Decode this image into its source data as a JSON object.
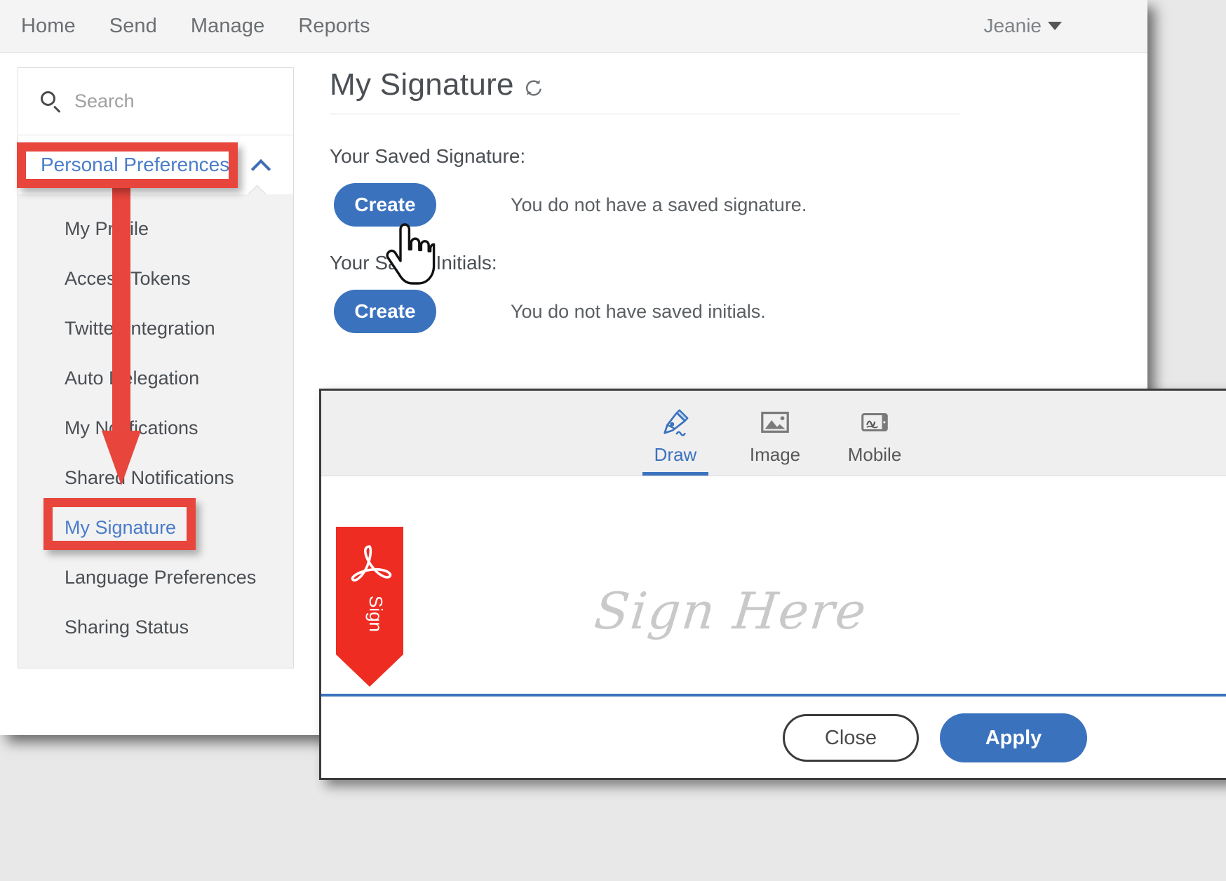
{
  "topnav": {
    "links": [
      {
        "label": "Home"
      },
      {
        "label": "Send"
      },
      {
        "label": "Manage"
      },
      {
        "label": "Reports"
      }
    ],
    "user": {
      "name": "Jeanie",
      "caret_icon": "chevron-down-icon"
    }
  },
  "sidebar": {
    "search": {
      "placeholder": "Search",
      "value": "",
      "icon": "search-icon"
    },
    "group": {
      "label": "Personal Preferences",
      "expanded": true,
      "toggle_icon": "chevron-up-icon"
    },
    "items": [
      {
        "label": "My Profile",
        "active": false
      },
      {
        "label": "Access Tokens",
        "active": false
      },
      {
        "label": "Twitter Integration",
        "active": false
      },
      {
        "label": "Auto Delegation",
        "active": false
      },
      {
        "label": "My Notifications",
        "active": false
      },
      {
        "label": "Shared Notifications",
        "active": false
      },
      {
        "label": "My Signature",
        "active": true
      },
      {
        "label": "Language Preferences",
        "active": false
      },
      {
        "label": "Sharing Status",
        "active": false
      }
    ]
  },
  "main": {
    "title": "My Signature",
    "refresh_icon": "refresh-icon",
    "signature_section": {
      "label": "Your Saved Signature:",
      "button_label": "Create",
      "status_text": "You do not have a saved signature."
    },
    "initials_section": {
      "label": "Your Saved Initials:",
      "button_label": "Create",
      "status_text": "You do not have saved initials."
    },
    "cursor_icon": "hand-pointer-cursor"
  },
  "signature_modal": {
    "tabs": [
      {
        "label": "Draw",
        "icon": "pen-draw-icon",
        "active": true
      },
      {
        "label": "Image",
        "icon": "image-picture-icon",
        "active": false
      },
      {
        "label": "Mobile",
        "icon": "mobile-tablet-signature-icon",
        "active": false
      }
    ],
    "canvas": {
      "flag_icon": "adobe-acrobat-sign-flag-icon",
      "flag_label": "Sign",
      "placeholder_text": "Sign Here",
      "baseline_color": "#3b72bd"
    },
    "footer": {
      "close_label": "Close",
      "apply_label": "Apply"
    }
  },
  "annotations": {
    "highlight_color": "#e8453c",
    "boxes": [
      {
        "target": "Personal Preferences"
      },
      {
        "target": "My Signature"
      }
    ],
    "arrow": {
      "direction": "down"
    }
  },
  "colors": {
    "accent_blue": "#3b72bd",
    "link_blue": "#4a7cc9",
    "annotation_red": "#e8453c",
    "acrobat_red": "#ee2c22",
    "nav_text": "#6b6f73"
  }
}
